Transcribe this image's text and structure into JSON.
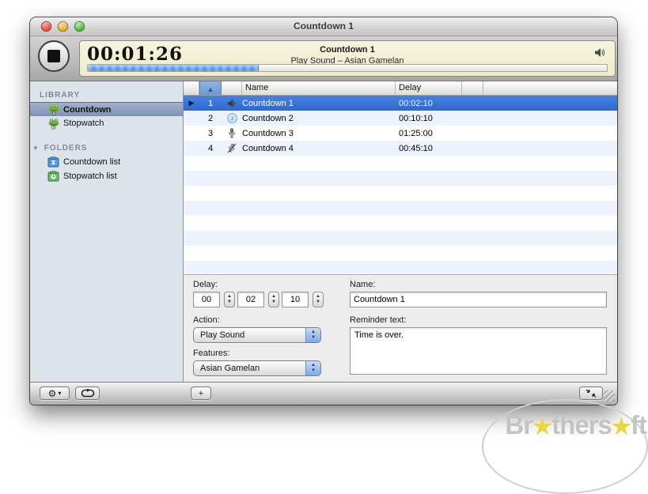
{
  "window": {
    "title": "Countdown 1"
  },
  "toolbar": {
    "timer": "00:01:26",
    "lcd_title": "Countdown 1",
    "lcd_subtitle": "Play Sound – Asian Gamelan",
    "progress_width": "33%",
    "icons": [
      "stop-button",
      "speaker-icon"
    ]
  },
  "sidebar": {
    "library_header": "LIBRARY",
    "folders_header": "FOLDERS",
    "library_items": [
      {
        "label": "Countdown",
        "icon": "frog-countdown-icon",
        "selected": true
      },
      {
        "label": "Stopwatch",
        "icon": "frog-stopwatch-icon",
        "selected": false
      }
    ],
    "folder_items": [
      {
        "label": "Countdown list",
        "icon": "countdown-list-icon"
      },
      {
        "label": "Stopwatch list",
        "icon": "stopwatch-list-icon"
      }
    ]
  },
  "table": {
    "columns": {
      "name": "Name",
      "delay": "Delay"
    },
    "sort_arrow": "▲",
    "play_marker": "▶",
    "rows": [
      {
        "num": "1",
        "icon": "speaker-icon",
        "name": "Countdown 1",
        "delay": "00:02:10",
        "selected": true
      },
      {
        "num": "2",
        "icon": "music-icon",
        "name": "Countdown 2",
        "delay": "00:10:10",
        "selected": false
      },
      {
        "num": "3",
        "icon": "microphone-icon",
        "name": "Countdown 3",
        "delay": "01:25:00",
        "selected": false
      },
      {
        "num": "4",
        "icon": "microphone-muted-icon",
        "name": "Countdown 4",
        "delay": "00:45:10",
        "selected": false
      }
    ]
  },
  "form": {
    "delay_label": "Delay:",
    "delay_fields": [
      "00",
      "02",
      "10"
    ],
    "action_label": "Action:",
    "action_value": "Play Sound",
    "features_label": "Features:",
    "features_value": "Asian Gamelan",
    "name_label": "Name:",
    "name_value": "Countdown 1",
    "reminder_label": "Reminder text:",
    "reminder_value": "Time is over."
  },
  "bottombar": {
    "gear_glyph": "⚙",
    "gear_arrow": "▾",
    "add_label": "+",
    "icons": [
      "gear-menu-button",
      "loop-button",
      "add-button",
      "collapse-button",
      "resize-grip"
    ]
  },
  "watermark": {
    "part1": "Br",
    "part2": "thers",
    "part3": "ft",
    "star": "★"
  },
  "colors": {
    "selection_blue": "#3B76D8",
    "sidebar_selection": "#7D93B4",
    "lcd_background": "#F2EED3",
    "progress_blue": "#5B93E1",
    "stripe_blue": "#EDF3FE",
    "sidebar_background": "#DCE3EA"
  }
}
